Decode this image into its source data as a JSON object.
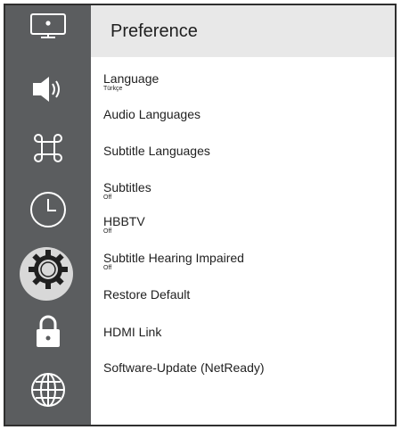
{
  "header": {
    "title": "Preference"
  },
  "sidebar": {
    "items": [
      {
        "name": "picture",
        "icon": "monitor-icon"
      },
      {
        "name": "sound",
        "icon": "speaker-icon"
      },
      {
        "name": "apps",
        "icon": "command-icon"
      },
      {
        "name": "timer",
        "icon": "clock-icon"
      },
      {
        "name": "settings",
        "icon": "gear-icon",
        "selected": true
      },
      {
        "name": "lock",
        "icon": "lock-icon"
      },
      {
        "name": "network",
        "icon": "globe-icon"
      }
    ]
  },
  "menu": {
    "items": [
      {
        "label": "Language",
        "value": "Türkçe"
      },
      {
        "label": "Audio Languages"
      },
      {
        "label": "Subtitle Languages"
      },
      {
        "label": "Subtitles",
        "value": "Off"
      },
      {
        "label": "HBBTV",
        "value": "Off"
      },
      {
        "label": "Subtitle Hearing Impaired",
        "value": "Off"
      },
      {
        "label": "Restore Default"
      },
      {
        "label": "HDMI Link"
      },
      {
        "label": "Software-Update (NetReady)"
      }
    ]
  },
  "colors": {
    "sidebar": "#5b5d5f",
    "header": "#e8e8e8",
    "selected": "#d8d8d8"
  }
}
